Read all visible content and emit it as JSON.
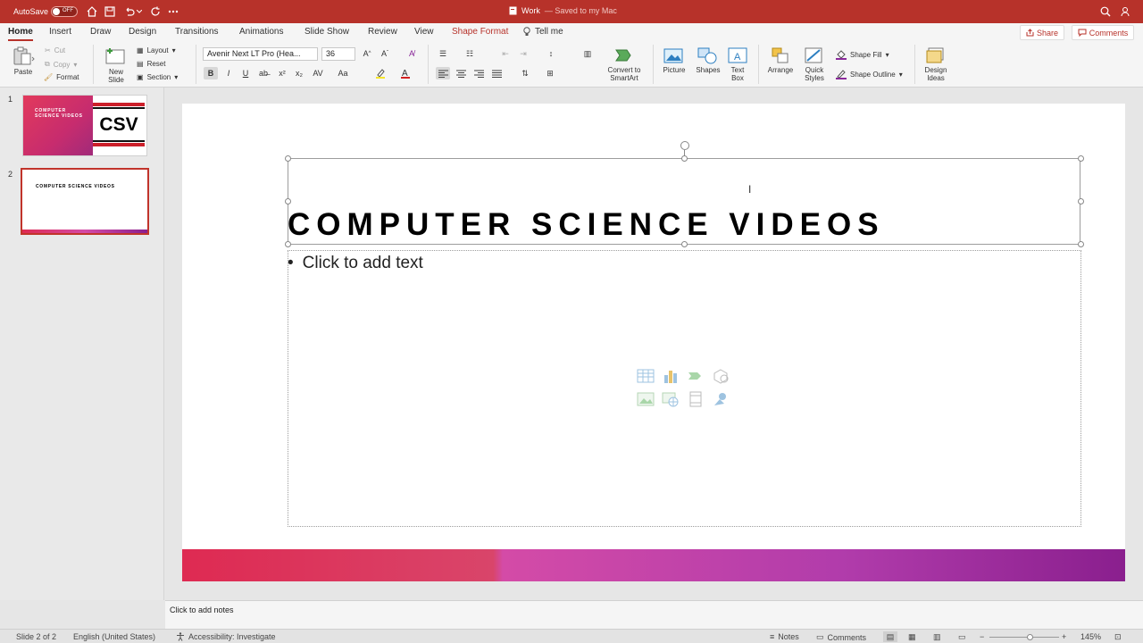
{
  "titlebar": {
    "autosave_label": "AutoSave",
    "autosave_state": "OFF",
    "doc_name": "Work",
    "doc_status": "— Saved to my Mac"
  },
  "tabs": [
    {
      "label": "Home"
    },
    {
      "label": "Insert"
    },
    {
      "label": "Draw"
    },
    {
      "label": "Design"
    },
    {
      "label": "Transitions"
    },
    {
      "label": "Animations"
    },
    {
      "label": "Slide Show"
    },
    {
      "label": "Review"
    },
    {
      "label": "View"
    },
    {
      "label": "Shape Format"
    },
    {
      "label": "Tell me"
    }
  ],
  "share_label": "Share",
  "comments_label": "Comments",
  "ribbon": {
    "paste": "Paste",
    "cut": "Cut",
    "copy": "Copy",
    "format": "Format",
    "new_slide_1": "New",
    "new_slide_2": "Slide",
    "layout": "Layout",
    "reset": "Reset",
    "section": "Section",
    "font_name": "Avenir Next LT Pro (Hea...",
    "font_size": "36",
    "bold": "B",
    "italic": "I",
    "underline": "U",
    "strike": "ab̶",
    "superscript": "x²",
    "subscript": "x₂",
    "char_spacing": "AV",
    "change_case": "Aa",
    "convert_1": "Convert to",
    "convert_2": "SmartArt",
    "picture": "Picture",
    "shapes": "Shapes",
    "textbox_1": "Text",
    "textbox_2": "Box",
    "arrange": "Arrange",
    "quick_1": "Quick",
    "quick_2": "Styles",
    "shape_fill": "Shape Fill",
    "shape_outline": "Shape Outline",
    "design_1": "Design",
    "design_2": "Ideas",
    "colors": {
      "highlight": "#f5e52a",
      "font_color": "#d22020",
      "fill": "#8a2a9a",
      "outline": "#8a2a9a"
    }
  },
  "slides": [
    {
      "number": "1",
      "thumb_title": "COMPUTER SCIENCE VIDEOS",
      "logo": "CSV"
    },
    {
      "number": "2",
      "thumb_title": "COMPUTER SCIENCE VIDEOS"
    }
  ],
  "slide": {
    "title": "COMPUTER SCIENCE VIDEOS",
    "body_bullet": "•",
    "body_placeholder": "Click to add text"
  },
  "placeholder_icons": [
    "table-icon",
    "chart-icon",
    "smartart-icon",
    "3d-model-icon",
    "picture-icon",
    "online-picture-icon",
    "video-icon",
    "icons-icon"
  ],
  "notes_placeholder": "Click to add notes",
  "status": {
    "slide_count": "Slide 2 of 2",
    "language": "English (United States)",
    "accessibility": "Accessibility: Investigate",
    "notes": "Notes",
    "comments": "Comments",
    "zoom_minus": "−",
    "zoom_plus": "+",
    "zoom": "145%"
  }
}
